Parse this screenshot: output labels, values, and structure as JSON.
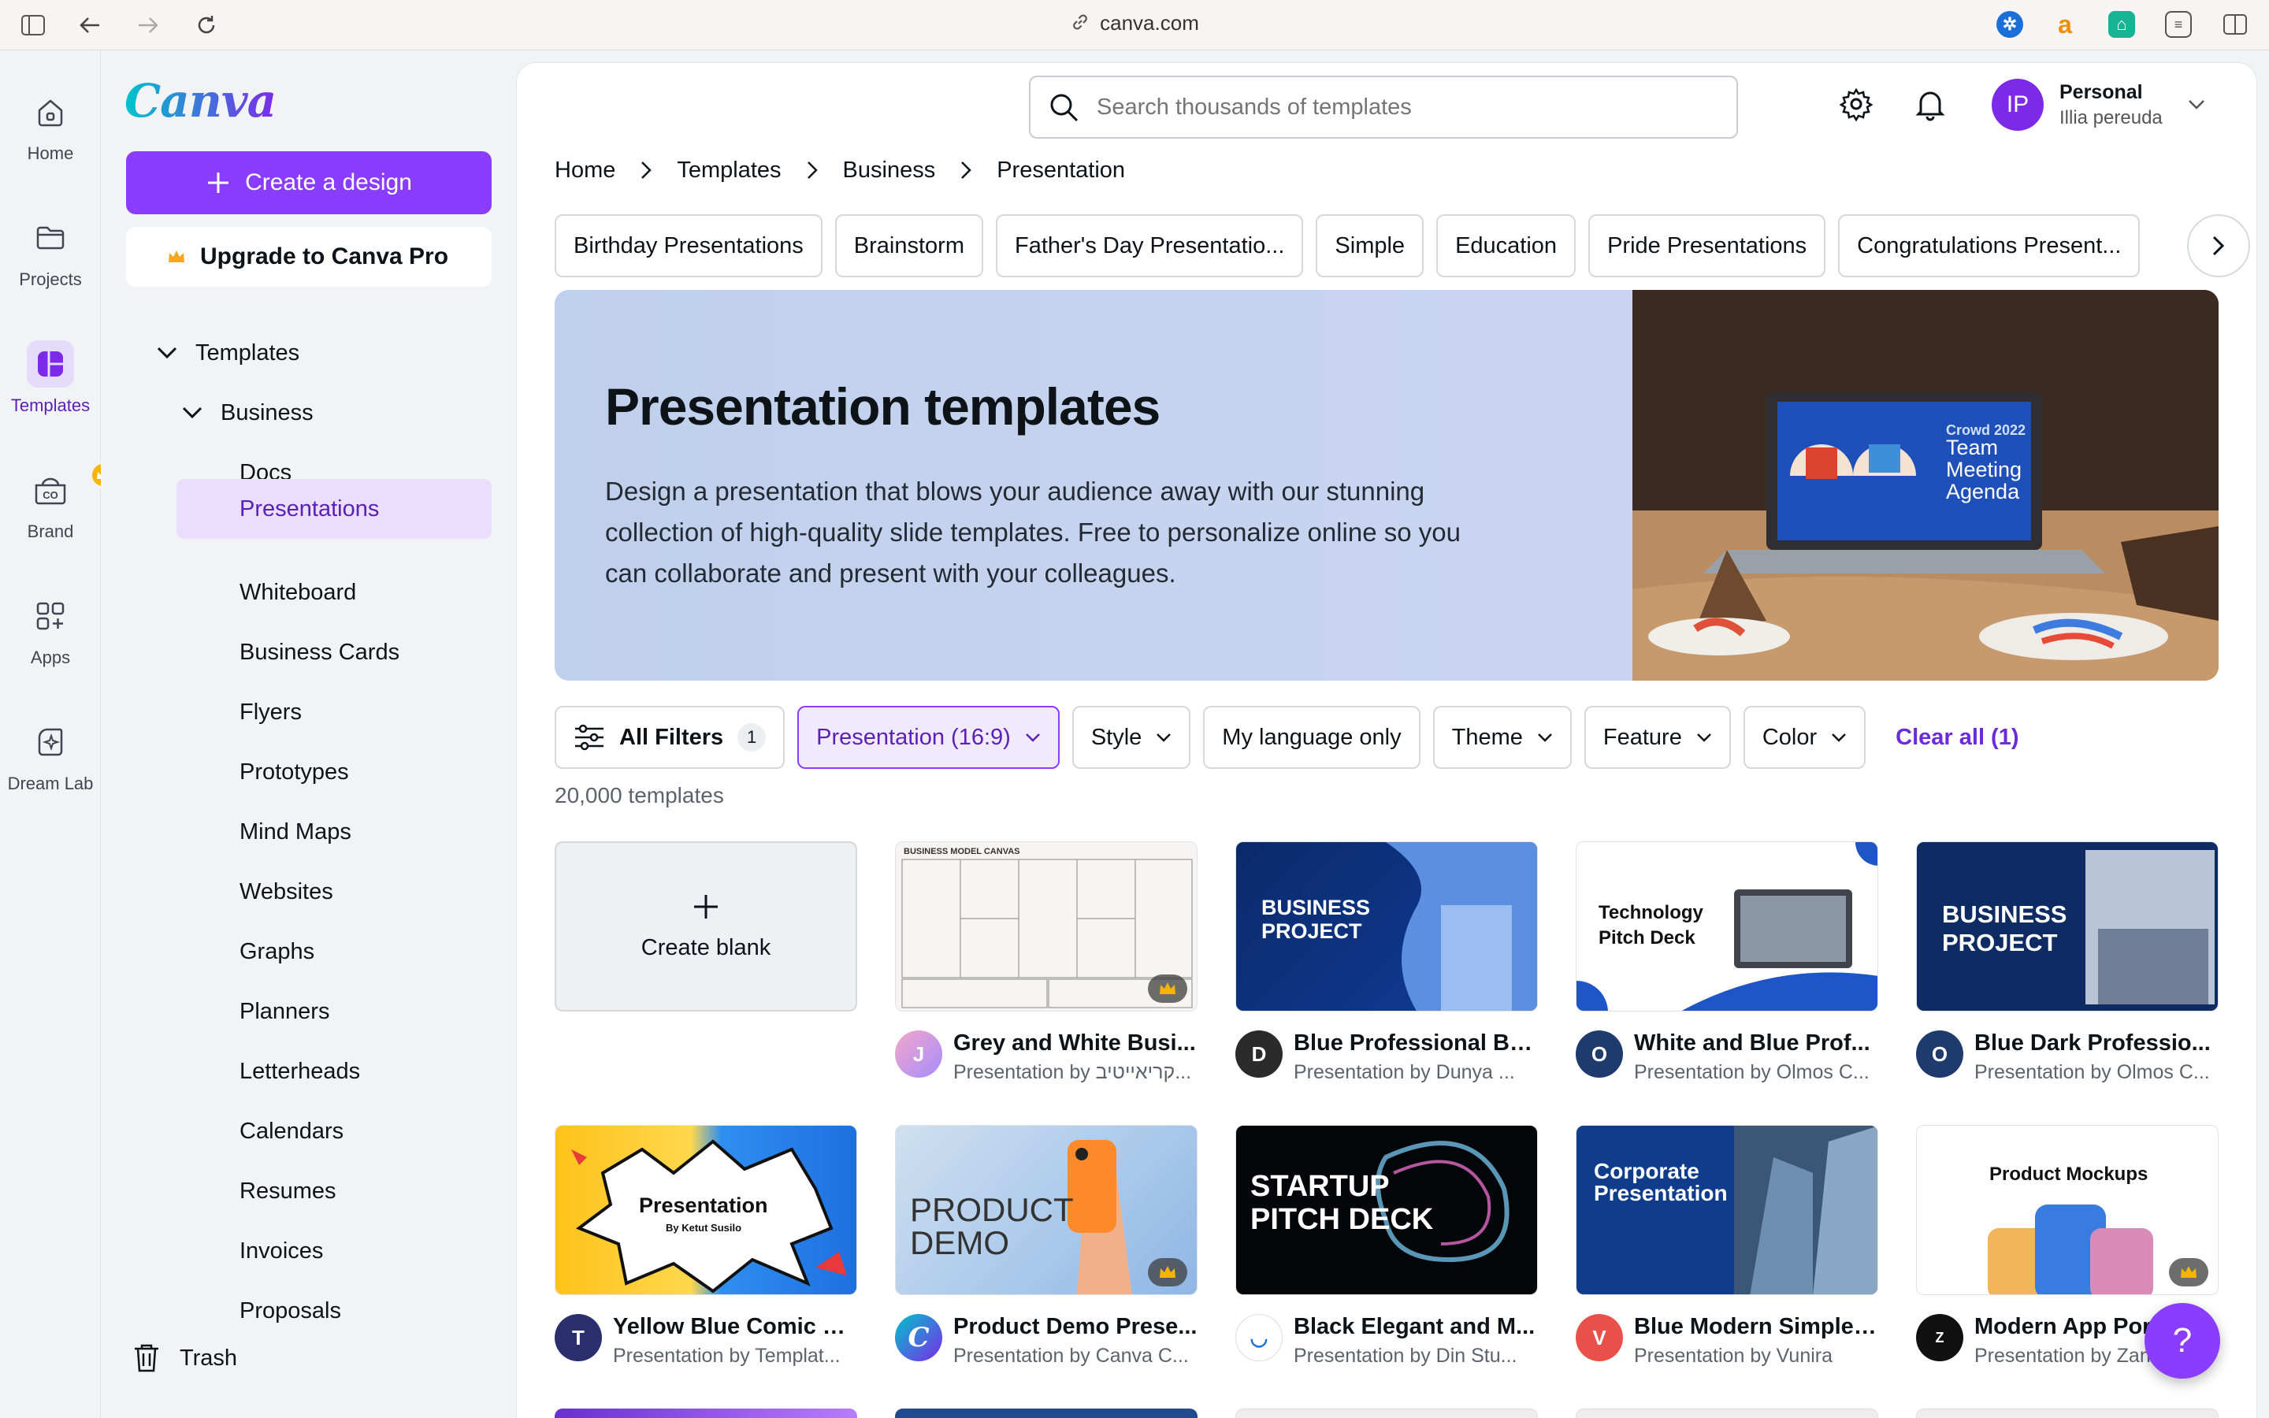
{
  "browser": {
    "url": "canva.com"
  },
  "rail": {
    "items": [
      {
        "label": "Home",
        "icon": "home-icon"
      },
      {
        "label": "Projects",
        "icon": "folder-icon"
      },
      {
        "label": "Templates",
        "icon": "templates-icon",
        "active": true
      },
      {
        "label": "Brand",
        "icon": "brand-icon"
      },
      {
        "label": "Apps",
        "icon": "apps-icon"
      },
      {
        "label": "Dream Lab",
        "icon": "dream-lab-icon"
      }
    ]
  },
  "sidebar": {
    "logo": "Canva",
    "create_label": "Create a design",
    "upgrade_label": "Upgrade to Canva Pro",
    "tree": {
      "templates": "Templates",
      "business": "Business",
      "items": [
        "Docs",
        "Presentations",
        "Whiteboard",
        "Business Cards",
        "Flyers",
        "Prototypes",
        "Mind Maps",
        "Websites",
        "Graphs",
        "Planners",
        "Letterheads",
        "Calendars",
        "Resumes",
        "Invoices",
        "Proposals"
      ],
      "selected": "Presentations"
    },
    "trash_label": "Trash"
  },
  "header": {
    "search_placeholder": "Search thousands of templates",
    "account_name": "Personal",
    "account_user": "Illia pereuda",
    "avatar_initials": "IP"
  },
  "breadcrumb": [
    "Home",
    "Templates",
    "Business",
    "Presentation"
  ],
  "chips": [
    "Birthday Presentations",
    "Brainstorm",
    "Father's Day Presentatio...",
    "Simple",
    "Education",
    "Pride Presentations",
    "Congratulations Present..."
  ],
  "hero": {
    "title": "Presentation templates",
    "description": "Design a presentation that blows your audience away with our stunning collection of high-quality slide templates. Free to personalize online so you can collaborate and present with your colleagues.",
    "laptop_brand": "Crowd 2022",
    "laptop_title": "Team Meeting Agenda"
  },
  "filters": {
    "all_filters": "All Filters",
    "all_filters_count": "1",
    "presentation": "Presentation (16:9)",
    "style": "Style",
    "language": "My language only",
    "theme": "Theme",
    "feature": "Feature",
    "color": "Color",
    "clear_all": "Clear all (1)"
  },
  "count": "20,000 templates",
  "create_blank": "Create blank",
  "templates": [
    {
      "title": "Grey and White Busi...",
      "by": "Presentation by קריאייטיב...",
      "thumb_text": "BUSINESS MODEL CANVAS"
    },
    {
      "title": "Blue Professional Bu...",
      "by": "Presentation by Dunya ...",
      "thumb_text": "BUSINESS PROJECT"
    },
    {
      "title": "White and Blue Prof...",
      "by": "Presentation by Olmos C...",
      "thumb_text": "Technology Pitch Deck"
    },
    {
      "title": "Blue Dark Professio...",
      "by": "Presentation by Olmos C...",
      "thumb_text": "BUSINESS PROJECT"
    },
    {
      "title": "Yellow Blue Comic D...",
      "by": "Presentation by Templat...",
      "thumb_text": "Presentation",
      "thumb_sub": "By Ketut Susilo"
    },
    {
      "title": "Product Demo Prese...",
      "by": "Presentation by Canva C...",
      "thumb_text": "PRODUCT DEMO"
    },
    {
      "title": "Black Elegant and M...",
      "by": "Presentation by Din Stu...",
      "thumb_text": "STARTUP PITCH DECK"
    },
    {
      "title": "Blue Modern Simple ...",
      "by": "Presentation by Vunira",
      "thumb_text": "Corporate Presentation"
    },
    {
      "title": "Modern App Port...",
      "by": "Presentation by Zan...",
      "thumb_text": "Product Mockups"
    }
  ],
  "help": "?",
  "colors": {
    "accent": "#8b3dff",
    "hero_bg": "#c3d2ee"
  }
}
